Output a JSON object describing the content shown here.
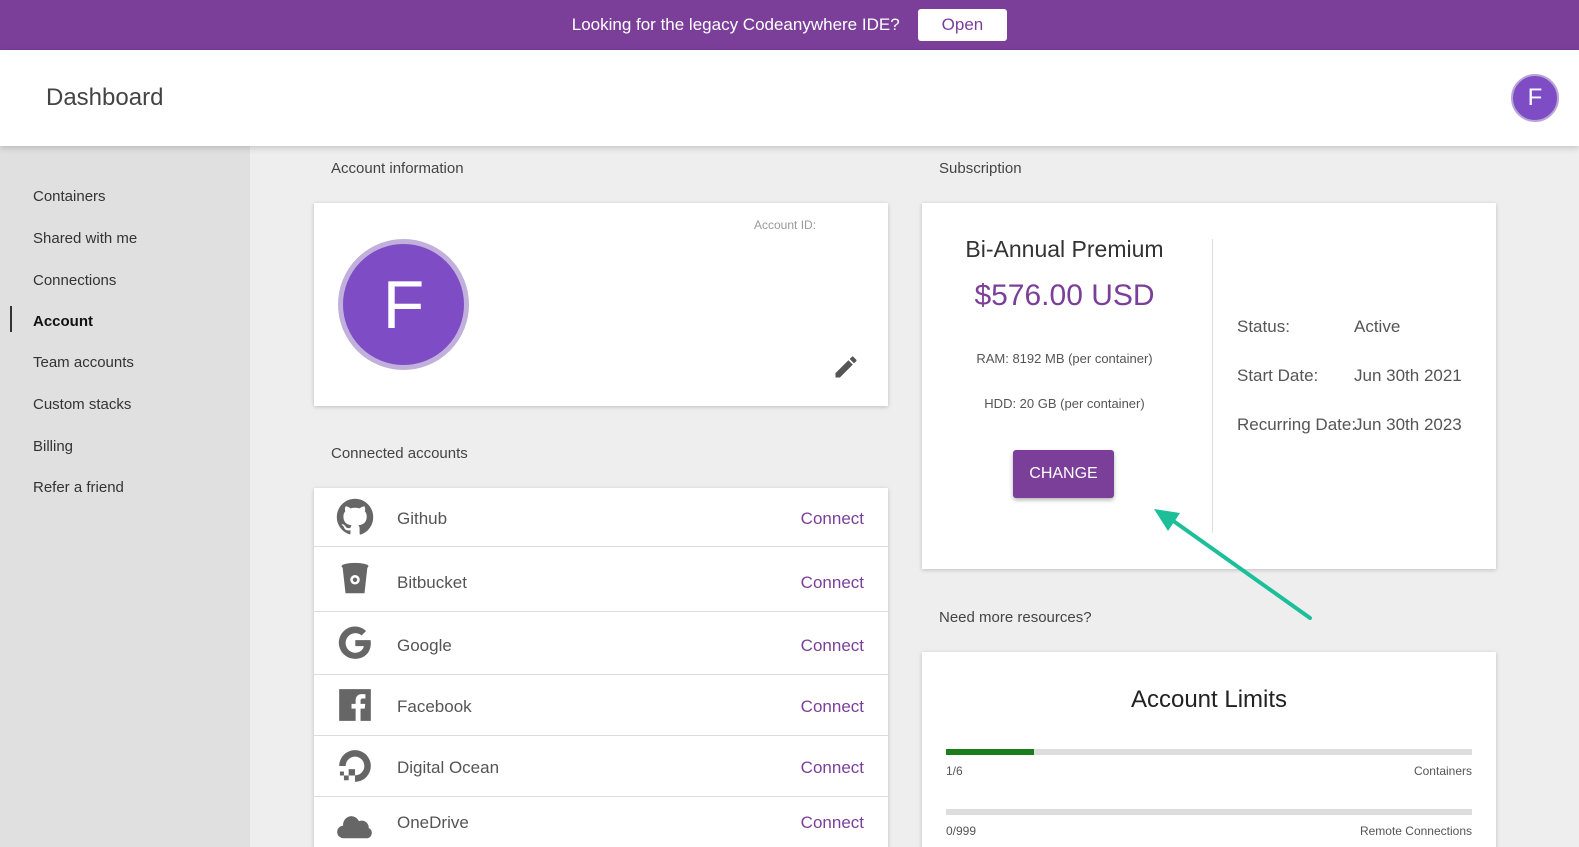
{
  "banner": {
    "text": "Looking for the legacy Codeanywhere IDE?",
    "button_label": "Open"
  },
  "header": {
    "title": "Dashboard",
    "avatar_letter": "F"
  },
  "sidebar": {
    "items": [
      {
        "label": "Containers"
      },
      {
        "label": "Shared with me"
      },
      {
        "label": "Connections"
      },
      {
        "label": "Account"
      },
      {
        "label": "Team accounts"
      },
      {
        "label": "Custom stacks"
      },
      {
        "label": "Billing"
      },
      {
        "label": "Refer a friend"
      }
    ],
    "active": "Account"
  },
  "account": {
    "section_label": "Account information",
    "avatar_letter": "F",
    "account_id_label": "Account ID:",
    "edit_icon": "pencil-icon"
  },
  "connected": {
    "section_label": "Connected accounts",
    "items": [
      {
        "name": "Github",
        "action": "Connect",
        "icon": "github-icon"
      },
      {
        "name": "Bitbucket",
        "action": "Connect",
        "icon": "bitbucket-icon"
      },
      {
        "name": "Google",
        "action": "Connect",
        "icon": "google-icon"
      },
      {
        "name": "Facebook",
        "action": "Connect",
        "icon": "facebook-icon"
      },
      {
        "name": "Digital Ocean",
        "action": "Connect",
        "icon": "digitalocean-icon"
      },
      {
        "name": "OneDrive",
        "action": "Connect",
        "icon": "onedrive-icon"
      }
    ]
  },
  "subscription": {
    "section_label": "Subscription",
    "plan_name": "Bi-Annual Premium",
    "price": "$576.00 USD",
    "ram": "RAM:  8192 MB  (per container)",
    "hdd": "HDD:  20 GB  (per container)",
    "change_label": "CHANGE",
    "status_key": "Status:",
    "status_value": "Active",
    "start_key": "Start Date:",
    "start_value": "Jun 30th 2021",
    "recurring_key": "Recurring Date:",
    "recurring_value": "Jun 30th 2023"
  },
  "resources": {
    "section_label": "Need more resources?",
    "title": "Account Limits",
    "limits": [
      {
        "count": "1/6",
        "name": "Containers",
        "used": 1,
        "max": 6
      },
      {
        "count": "0/999",
        "name": "Remote Connections",
        "used": 0,
        "max": 999
      }
    ]
  },
  "colors": {
    "brand": "#7b3f9a",
    "avatar": "#7e4cc4",
    "progress": "#1a7f1a",
    "annotation_arrow": "#1dbf9a"
  }
}
